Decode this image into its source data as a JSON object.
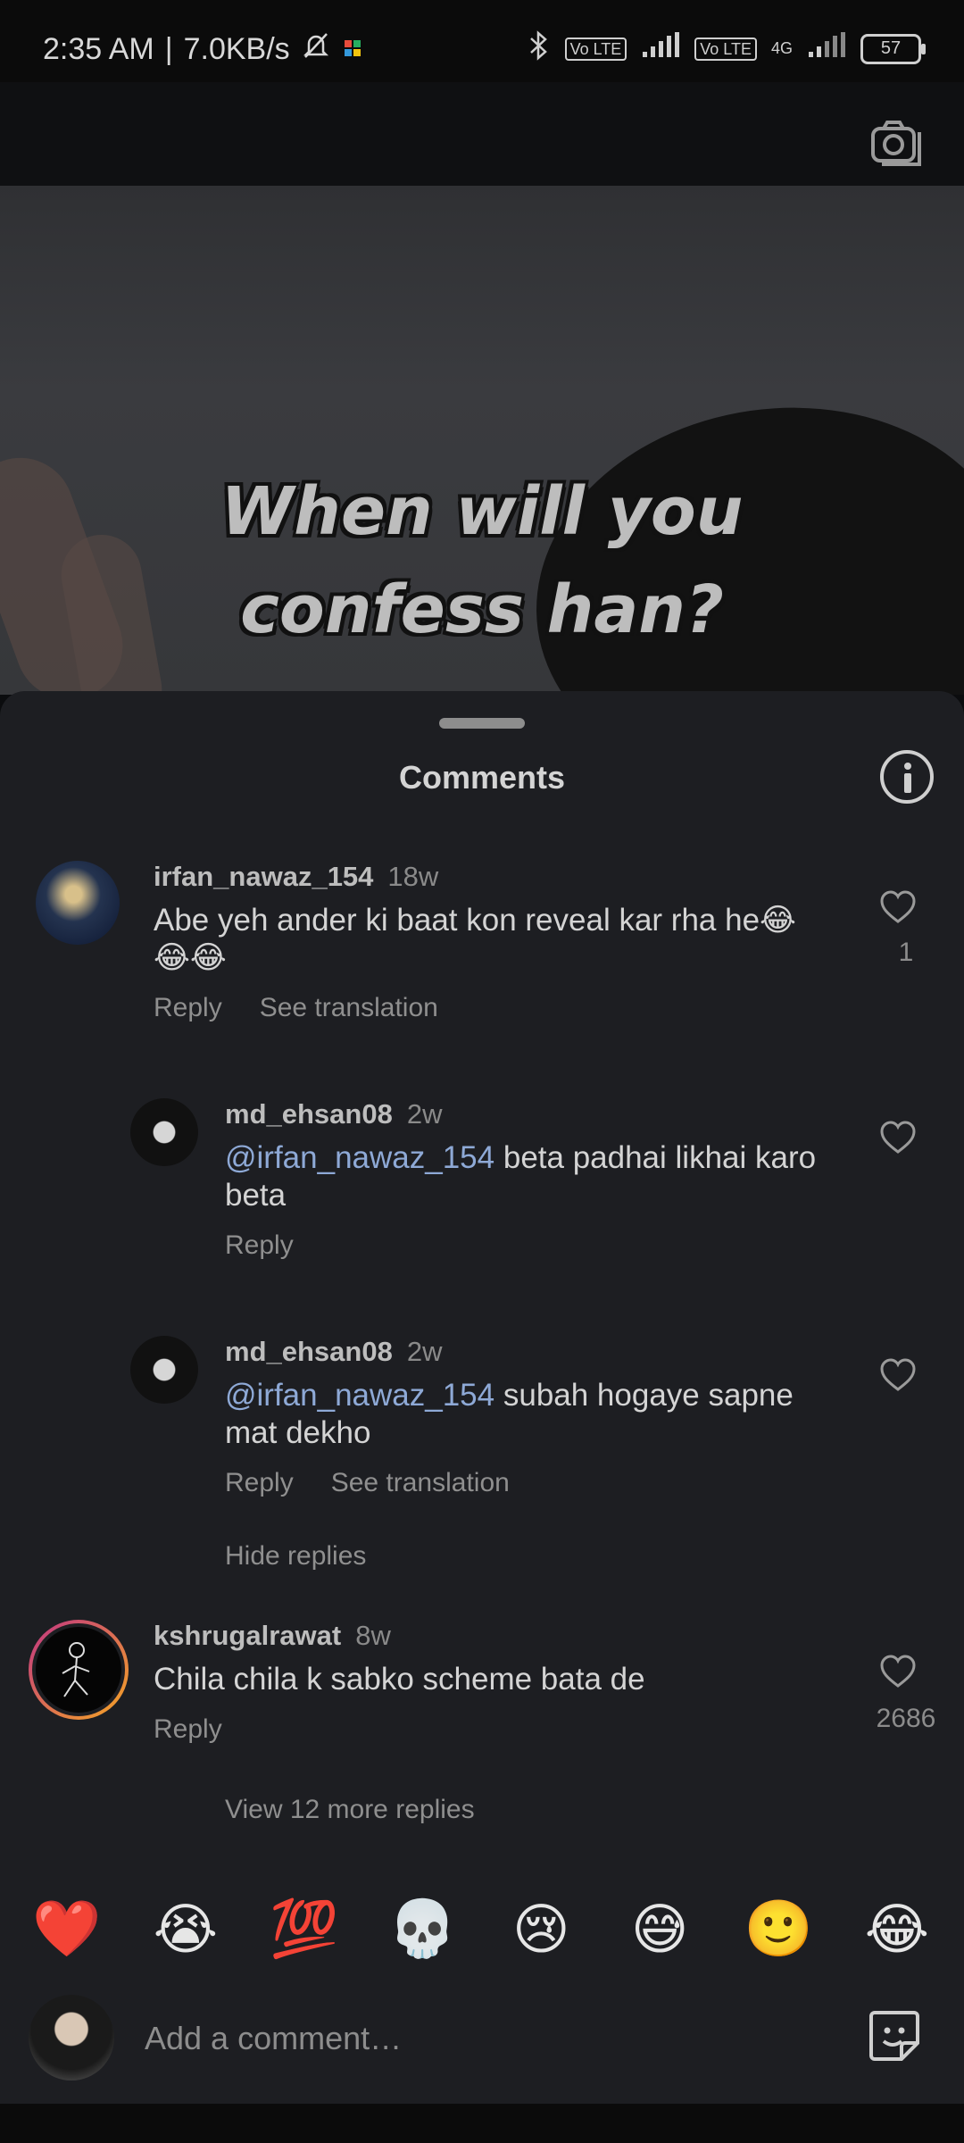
{
  "status_bar": {
    "time": "2:35 AM",
    "separator": "|",
    "speed": "7.0KB/s",
    "lte1": "Vo LTE",
    "lte2": "Vo LTE",
    "network": "4G",
    "battery": "57"
  },
  "video": {
    "overlay_line1": "When will you",
    "overlay_line2": "confess han?"
  },
  "sheet": {
    "title": "Comments"
  },
  "comments": [
    {
      "username": "irfan_nawaz_154",
      "time": "18w",
      "text": "Abe yeh ander ki baat kon reveal kar rha he😂😂😂",
      "reply": "Reply",
      "translate": "See translation",
      "likes": "1"
    },
    {
      "username": "md_ehsan08",
      "time": "2w",
      "mention": "@irfan_nawaz_154",
      "text": " beta padhai likhai karo beta",
      "reply": "Reply"
    },
    {
      "username": "md_ehsan08",
      "time": "2w",
      "mention": "@irfan_nawaz_154",
      "text": " subah hogaye sapne mat dekho",
      "reply": "Reply",
      "translate": "See translation"
    },
    {
      "username": "kshrugalrawat",
      "time": "8w",
      "text": "Chila chila k sabko scheme bata de",
      "reply": "Reply",
      "likes": "2686"
    }
  ],
  "hide_replies": "Hide replies",
  "view_more_replies": "View 12 more replies",
  "emojis": [
    "❤️",
    "😭",
    "💯",
    "💀",
    "😢",
    "😅",
    "🙂",
    "😂"
  ],
  "input": {
    "placeholder": "Add a comment…"
  },
  "colors": {
    "sheet_bg": "#1d1e22",
    "mention": "#8ea9d6",
    "story_ring_start": "#c13584",
    "story_ring_end": "#f5a623"
  },
  "icons": [
    "bluetooth-icon",
    "mute-icon",
    "camera-icon",
    "info-icon",
    "heart-icon",
    "sticker-icon"
  ]
}
